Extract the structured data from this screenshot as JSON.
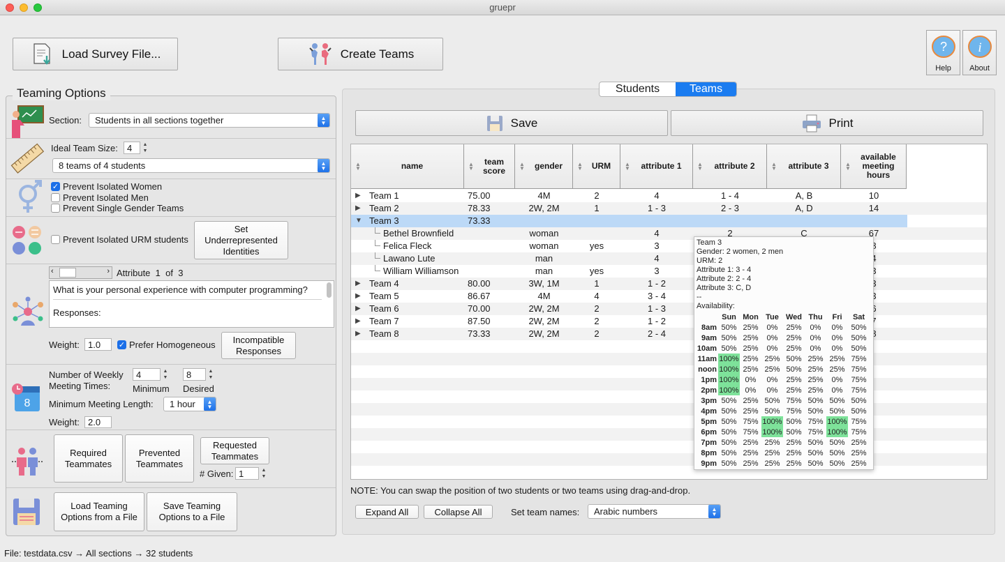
{
  "window": {
    "title": "gruepr"
  },
  "toolbar": {
    "load_survey": "Load Survey File...",
    "create_teams": "Create Teams",
    "help": "Help",
    "about": "About"
  },
  "options": {
    "title": "Teaming Options",
    "section_label": "Section:",
    "section_value": "Students in all sections together",
    "ideal_size_label": "Ideal Team Size:",
    "ideal_size_value": "4",
    "team_count_value": "8 teams of 4 students",
    "prevent_isolated_women": "Prevent Isolated Women",
    "prevent_isolated_men": "Prevent Isolated Men",
    "prevent_single_gender": "Prevent Single Gender Teams",
    "prevent_isolated_urm": "Prevent Isolated URM students",
    "set_underrep_button": "Set Underrepresented Identities",
    "attribute_label": "Attribute",
    "attribute_index": "1",
    "attribute_of": "of",
    "attribute_total": "3",
    "attribute_question": "What is your personal experience with computer programming?",
    "attribute_responses": "Responses:",
    "weight_label": "Weight:",
    "attribute_weight": "1.0",
    "prefer_homogeneous": "Prefer Homogeneous",
    "incompatible_button": "Incompatible Responses",
    "weekly_meeting_label_1": "Number of Weekly",
    "weekly_meeting_label_2": "Meeting Times:",
    "min_meetings": "4",
    "desired_meetings": "8",
    "minimum_label": "Minimum",
    "desired_label": "Desired",
    "min_length_label": "Minimum Meeting Length:",
    "min_length_value": "1 hour",
    "schedule_weight": "2.0",
    "required_button": "Required Teammates",
    "prevented_button": "Prevented Teammates",
    "requested_button": "Requested Teammates",
    "given_label": "# Given:",
    "given_value": "1",
    "load_options_button": "Load Teaming Options from a File",
    "save_options_button": "Save Teaming Options to a File"
  },
  "tabs": {
    "students": "Students",
    "teams": "Teams"
  },
  "actions": {
    "save": "Save",
    "print": "Print"
  },
  "table": {
    "columns": [
      "name",
      "team score",
      "gender",
      "URM",
      "attribute 1",
      "attribute 2",
      "attribute 3",
      "available meeting hours"
    ],
    "rows": [
      {
        "name": "Team 1",
        "score": "75.00",
        "gender": "4M",
        "urm": "2",
        "a1": "4",
        "a2": "1 - 4",
        "a3": "A, B",
        "hours": "10",
        "type": "team",
        "state": "collapsed"
      },
      {
        "name": "Team 2",
        "score": "78.33",
        "gender": "2W, 2M",
        "urm": "1",
        "a1": "1 - 3",
        "a2": "2 - 3",
        "a3": "A, D",
        "hours": "14",
        "type": "team",
        "state": "collapsed"
      },
      {
        "name": "Team 3",
        "score": "73.33",
        "gender": "",
        "urm": "",
        "a1": "",
        "a2": "",
        "a3": "",
        "hours": "",
        "type": "team",
        "state": "expanded",
        "selected": true
      },
      {
        "name": "Bethel Brownfield",
        "score": "",
        "gender": "woman",
        "urm": "",
        "a1": "4",
        "a2": "2",
        "a3": "C",
        "hours": "67",
        "type": "student"
      },
      {
        "name": "Felica Fleck",
        "score": "",
        "gender": "woman",
        "urm": "yes",
        "a1": "3",
        "a2": "",
        "a3": "",
        "hours": "8",
        "type": "student"
      },
      {
        "name": "Lawano Lute",
        "score": "",
        "gender": "man",
        "urm": "",
        "a1": "4",
        "a2": "",
        "a3": "",
        "hours": "4",
        "type": "student"
      },
      {
        "name": "William Williamson",
        "score": "",
        "gender": "man",
        "urm": "yes",
        "a1": "3",
        "a2": "",
        "a3": "",
        "hours": "3",
        "type": "student"
      },
      {
        "name": "Team 4",
        "score": "80.00",
        "gender": "3W, 1M",
        "urm": "1",
        "a1": "1 - 2",
        "a2": "",
        "a3": "",
        "hours": "3",
        "type": "team",
        "state": "collapsed"
      },
      {
        "name": "Team 5",
        "score": "86.67",
        "gender": "4M",
        "urm": "4",
        "a1": "3 - 4",
        "a2": "",
        "a3": "",
        "hours": "3",
        "type": "team",
        "state": "collapsed"
      },
      {
        "name": "Team 6",
        "score": "70.00",
        "gender": "2W, 2M",
        "urm": "2",
        "a1": "1 - 3",
        "a2": "",
        "a3": "",
        "hours": "6",
        "type": "team",
        "state": "collapsed"
      },
      {
        "name": "Team 7",
        "score": "87.50",
        "gender": "2W, 2M",
        "urm": "2",
        "a1": "1 - 2",
        "a2": "",
        "a3": "",
        "hours": "7",
        "type": "team",
        "state": "collapsed"
      },
      {
        "name": "Team 8",
        "score": "73.33",
        "gender": "2W, 2M",
        "urm": "2",
        "a1": "2 - 4",
        "a2": "",
        "a3": "",
        "hours": "8",
        "type": "team",
        "state": "collapsed"
      }
    ]
  },
  "tooltip": {
    "lines": [
      "Team 3",
      "Gender: 2 women, 2 men",
      "URM: 2",
      "Attribute 1: 3 - 4",
      "Attribute 2: 2 - 4",
      "Attribute 3: C, D",
      "--",
      "Availability:"
    ],
    "days": [
      "Sun",
      "Mon",
      "Tue",
      "Wed",
      "Thu",
      "Fri",
      "Sat"
    ],
    "times": [
      {
        "t": "8am",
        "v": [
          "50%",
          "25%",
          "0%",
          "25%",
          "0%",
          "0%",
          "50%"
        ]
      },
      {
        "t": "9am",
        "v": [
          "50%",
          "25%",
          "0%",
          "25%",
          "0%",
          "0%",
          "50%"
        ]
      },
      {
        "t": "10am",
        "v": [
          "50%",
          "25%",
          "0%",
          "25%",
          "0%",
          "0%",
          "50%"
        ]
      },
      {
        "t": "11am",
        "v": [
          "100%",
          "25%",
          "25%",
          "50%",
          "25%",
          "25%",
          "75%"
        ]
      },
      {
        "t": "noon",
        "v": [
          "100%",
          "25%",
          "25%",
          "50%",
          "25%",
          "25%",
          "75%"
        ]
      },
      {
        "t": "1pm",
        "v": [
          "100%",
          "0%",
          "0%",
          "25%",
          "25%",
          "0%",
          "75%"
        ]
      },
      {
        "t": "2pm",
        "v": [
          "100%",
          "0%",
          "0%",
          "25%",
          "25%",
          "0%",
          "75%"
        ]
      },
      {
        "t": "3pm",
        "v": [
          "50%",
          "25%",
          "50%",
          "75%",
          "50%",
          "50%",
          "50%"
        ]
      },
      {
        "t": "4pm",
        "v": [
          "50%",
          "25%",
          "50%",
          "75%",
          "50%",
          "50%",
          "50%"
        ]
      },
      {
        "t": "5pm",
        "v": [
          "50%",
          "75%",
          "100%",
          "50%",
          "75%",
          "100%",
          "75%"
        ]
      },
      {
        "t": "6pm",
        "v": [
          "50%",
          "75%",
          "100%",
          "50%",
          "75%",
          "100%",
          "75%"
        ]
      },
      {
        "t": "7pm",
        "v": [
          "50%",
          "25%",
          "25%",
          "25%",
          "50%",
          "50%",
          "25%"
        ]
      },
      {
        "t": "8pm",
        "v": [
          "50%",
          "25%",
          "25%",
          "25%",
          "50%",
          "50%",
          "25%"
        ]
      },
      {
        "t": "9pm",
        "v": [
          "50%",
          "25%",
          "25%",
          "25%",
          "50%",
          "50%",
          "25%"
        ]
      }
    ],
    "highlight_value": "100%",
    "highlight_color": "#7ee29a"
  },
  "bottom": {
    "note": "NOTE: You can swap the position of two students or two teams using drag-and-drop.",
    "expand_all": "Expand All",
    "collapse_all": "Collapse All",
    "set_names_label": "Set team names:",
    "names_value": "Arabic numbers"
  },
  "status": {
    "text": "File: testdata.csv  → All sections  → 32 students"
  },
  "colors": {
    "accent": "#1b6fe8",
    "selected_row": "#bcd9f7",
    "tab_active": "#1b7cf0"
  }
}
